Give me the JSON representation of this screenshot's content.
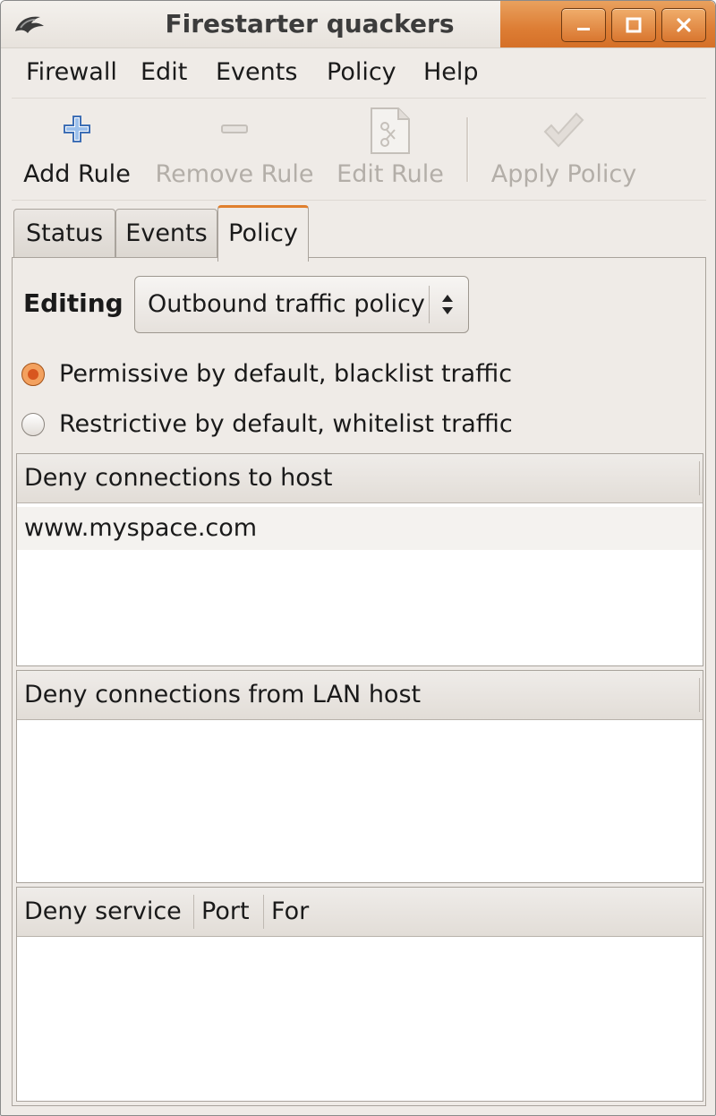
{
  "window": {
    "title": "Firestarter quackers",
    "controls": [
      "minimize",
      "maximize",
      "close"
    ]
  },
  "menubar": {
    "items": [
      {
        "label": "Firewall"
      },
      {
        "label": "Edit"
      },
      {
        "label": "Events"
      },
      {
        "label": "Policy"
      },
      {
        "label": "Help"
      }
    ]
  },
  "toolbar": {
    "add_rule": {
      "label": "Add Rule",
      "icon": "plus-icon",
      "enabled": true
    },
    "remove_rule": {
      "label": "Remove Rule",
      "icon": "minus-icon",
      "enabled": false
    },
    "edit_rule": {
      "label": "Edit Rule",
      "icon": "document-edit-icon",
      "enabled": false
    },
    "apply_policy": {
      "label": "Apply Policy",
      "icon": "checkmark-icon",
      "enabled": false
    }
  },
  "tabs": [
    {
      "label": "Status",
      "active": false
    },
    {
      "label": "Events",
      "active": false
    },
    {
      "label": "Policy",
      "active": true
    }
  ],
  "policy": {
    "editing_label": "Editing",
    "editing_value": "Outbound traffic policy",
    "radios": [
      {
        "label": "Permissive by default, blacklist traffic",
        "checked": true
      },
      {
        "label": "Restrictive by default, whitelist traffic",
        "checked": false
      }
    ],
    "deny_hosts": {
      "header": "Deny connections to host",
      "rows": [
        "www.myspace.com"
      ]
    },
    "deny_lan": {
      "header": "Deny connections from LAN host",
      "rows": []
    },
    "deny_service": {
      "columns": [
        "Deny service",
        "Port",
        "For"
      ],
      "rows": []
    }
  },
  "colors": {
    "accent": "#dd7d34",
    "window_bg": "#efebe7",
    "disabled_text": "#b3aea8",
    "radio_selected": "#d8561f"
  }
}
